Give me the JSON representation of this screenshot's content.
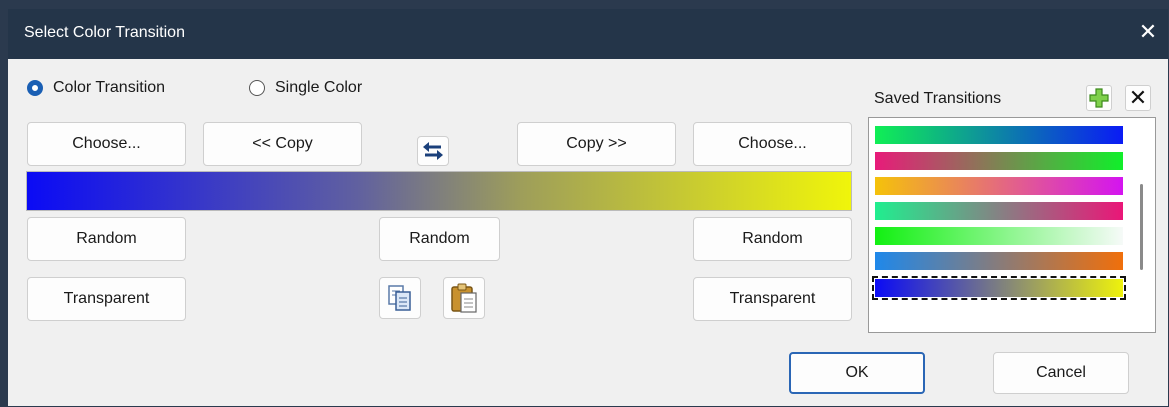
{
  "window": {
    "title": "Select Color Transition"
  },
  "mode": {
    "options": [
      "Color Transition",
      "Single Color"
    ],
    "selected": "Color Transition"
  },
  "buttons": {
    "choose_left": "Choose...",
    "copy_left": "<< Copy",
    "copy_right": "Copy >>",
    "choose_right": "Choose...",
    "random_left": "Random",
    "random_center": "Random",
    "random_right": "Random",
    "transparent_left": "Transparent",
    "transparent_right": "Transparent",
    "ok": "OK",
    "cancel": "Cancel"
  },
  "current_transition": {
    "start_color": "#0b0bf5",
    "end_color": "#f0f50a"
  },
  "saved": {
    "label": "Saved Transitions",
    "swatches": [
      {
        "from": "#10ef55",
        "to": "#0a1bf5"
      },
      {
        "from": "#e81b7a",
        "to": "#10ef2a"
      },
      {
        "from": "#f5c20a",
        "to": "#d414f0"
      },
      {
        "from": "#20ee8f",
        "to": "#ea1678"
      },
      {
        "from": "#12f012",
        "to": "#f6faf8"
      },
      {
        "from": "#1f88ea",
        "to": "#f06f0b"
      },
      {
        "from": "#0b0bf5",
        "to": "#eef20c",
        "selected": true
      }
    ]
  },
  "colors": {
    "titlebar": "#243549",
    "accent": "#1a5fb4",
    "dialog_bg": "#f0f0f0"
  }
}
